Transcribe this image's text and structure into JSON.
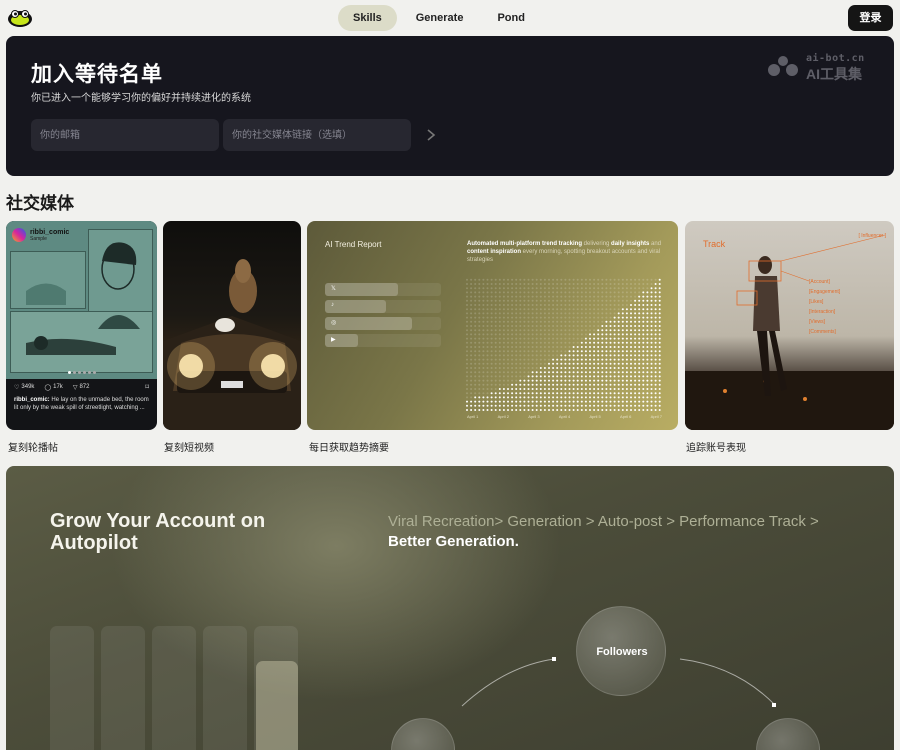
{
  "nav": {
    "tabs": [
      {
        "label": "Skills",
        "active": true
      },
      {
        "label": "Generate",
        "active": false
      },
      {
        "label": "Pond",
        "active": false
      }
    ],
    "login_label": "登录",
    "logo_icon": "frog-logo-icon"
  },
  "waitlist": {
    "title": "加入等待名单",
    "subtitle": "你已进入一个能够学习你的偏好并持续进化的系统",
    "email_placeholder": "你的邮箱",
    "link_placeholder": "你的社交媒体链接（选填）",
    "submit_icon": "chevron-right-icon"
  },
  "watermark": {
    "domain": "ai-bot.cn",
    "name": "AI工具集"
  },
  "section": {
    "title": "社交媒体"
  },
  "cards": [
    {
      "label": "复刻轮播帖",
      "username": "ribbi_comic",
      "subusername": "Sample",
      "likes": "349k",
      "comments": "17k",
      "shares": "872",
      "caption_user": "ribbi_comic:",
      "caption_text": "He lay on the unmade bed, the room lit only by the weak spill of streetlight, watching ..."
    },
    {
      "label": "复刻短视频"
    },
    {
      "label": "每日获取趋势摘要",
      "report_title": "AI Trend Report",
      "desc_a": "Automated multi-platform trend tracking",
      "desc_b": " delivering ",
      "desc_c": "daily insights",
      "desc_d": " and ",
      "desc_e": "content inspiration",
      "desc_f": " every morning, spotting breakout accounts and viral strategies",
      "platforms": [
        "𝕏",
        "♪",
        "◎",
        "▶"
      ],
      "x_labels": [
        "April 1",
        "April 2",
        "April 3",
        "April 4",
        "April 5",
        "April 6",
        "April 7"
      ]
    },
    {
      "label": "追踪账号表现",
      "track_title": "Track",
      "influencer": "[ Influencer ]",
      "metrics": [
        "[Account]",
        "[Engagement]",
        "[Likes]",
        "[Interaction]",
        "[Views]",
        "[Comments]"
      ]
    }
  ],
  "autopilot": {
    "title": "Grow Your Account on Autopilot",
    "flow_a": "Viral Recreation> Generation >  Auto-post > Performance Track > ",
    "flow_b": "Better Generation.",
    "followers_label": "Followers"
  },
  "colors": {
    "dark_panel": "#16161e",
    "accent_orange": "#e26d2c",
    "active_tab": "#dcdcc8"
  }
}
